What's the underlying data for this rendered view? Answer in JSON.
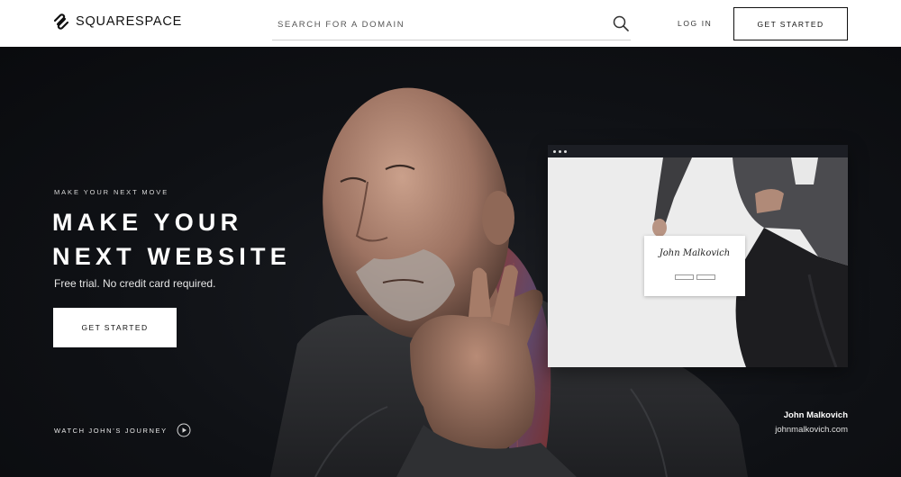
{
  "header": {
    "brand": "SQUARESPACE",
    "search_placeholder": "SEARCH FOR A DOMAIN",
    "login_label": "LOG IN",
    "cta_label": "GET STARTED"
  },
  "hero": {
    "eyebrow": "MAKE YOUR NEXT MOVE",
    "headline_line1": "MAKE YOUR",
    "headline_line2": "NEXT WEBSITE",
    "subline": "Free trial. No credit card required.",
    "cta_label": "GET STARTED",
    "journey_label": "WATCH JOHN’S JOURNEY",
    "journey_icon": "play-circle-icon"
  },
  "mockup": {
    "signature": "John Malkovich"
  },
  "caption": {
    "name": "John Malkovich",
    "url": "johnmalkovich.com"
  },
  "colors": {
    "header_bg": "#ffffff",
    "hero_bg": "#0f1115",
    "text_light": "#ffffff"
  }
}
